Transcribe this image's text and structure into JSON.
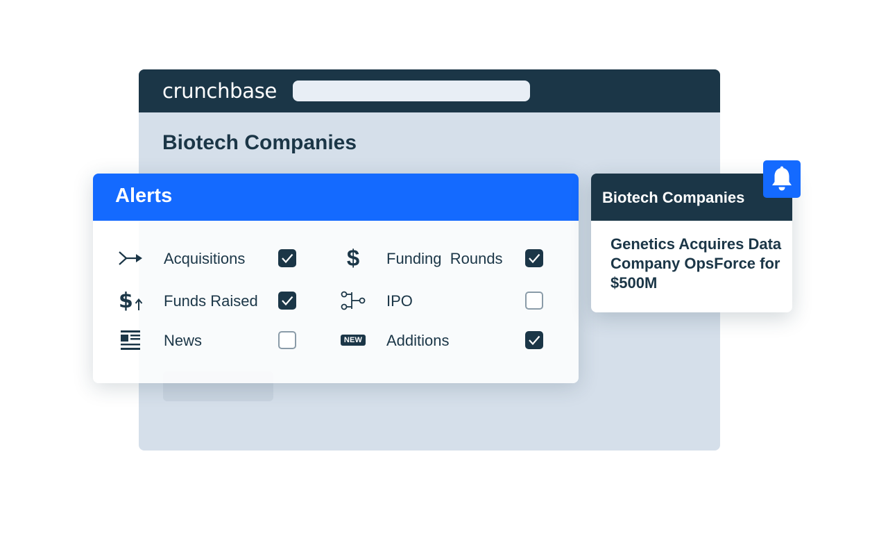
{
  "header": {
    "brand": "crunchbase",
    "search_placeholder": ""
  },
  "page": {
    "title": "Biotech Companies"
  },
  "alerts": {
    "title": "Alerts",
    "items": [
      {
        "label": "Acquisitions",
        "icon": "acquisition-arrow-icon",
        "checked": true
      },
      {
        "label": "Funding  Rounds",
        "icon": "dollar-icon",
        "checked": true
      },
      {
        "label": "Funds Raised",
        "icon": "funds-raised-icon",
        "checked": true
      },
      {
        "label": "IPO",
        "icon": "ipo-icon",
        "checked": false
      },
      {
        "label": "News",
        "icon": "news-icon",
        "checked": false
      },
      {
        "label": "Additions",
        "icon": "new-badge-icon",
        "checked": true
      }
    ],
    "new_badge": "NEW"
  },
  "notification": {
    "title": "Biotech Companies",
    "headline": "Genetics Acquires Data Company OpsForce for $500M",
    "icon": "bell-icon"
  },
  "colors": {
    "navy": "#1b3647",
    "blue": "#146aff",
    "page_bg": "#d5dfea"
  }
}
